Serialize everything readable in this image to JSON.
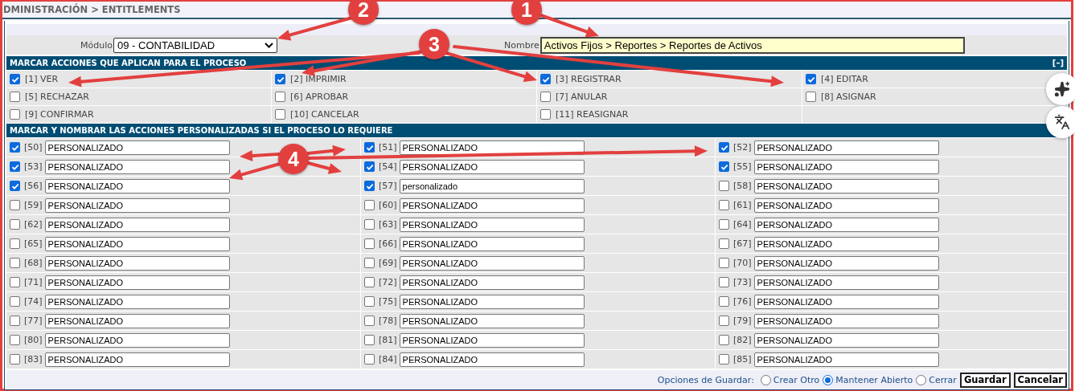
{
  "breadcrumb": "DMINISTRACIÓN > ENTITLEMENTS",
  "module": {
    "label": "Módulo",
    "value": "09 - CONTABILIDAD"
  },
  "name": {
    "label": "Nombre",
    "value": "Activos Fijos > Reportes > Reportes de Activos"
  },
  "standard_actions": {
    "title": "MARCAR ACCIONES QUE APLICAN PARA EL PROCESO",
    "toggle": "[–]",
    "items": [
      {
        "code": "[1]",
        "label": "VER",
        "checked": true
      },
      {
        "code": "[2]",
        "label": "IMPRIMIR",
        "checked": true
      },
      {
        "code": "[3]",
        "label": "REGISTRAR",
        "checked": true
      },
      {
        "code": "[4]",
        "label": "EDITAR",
        "checked": true
      },
      {
        "code": "[5]",
        "label": "RECHAZAR",
        "checked": false
      },
      {
        "code": "[6]",
        "label": "APROBAR",
        "checked": false
      },
      {
        "code": "[7]",
        "label": "ANULAR",
        "checked": false
      },
      {
        "code": "[8]",
        "label": "ASIGNAR",
        "checked": false
      },
      {
        "code": "[9]",
        "label": "CONFIRMAR",
        "checked": false
      },
      {
        "code": "[10]",
        "label": "CANCELAR",
        "checked": false
      },
      {
        "code": "[11]",
        "label": "REASIGNAR",
        "checked": false
      }
    ]
  },
  "custom_actions": {
    "title": "MARCAR Y NOMBRAR LAS ACCIONES PERSONALIZADAS SI EL PROCESO LO REQUIERE",
    "items": [
      {
        "code": "[50]",
        "value": "PERSONALIZADO",
        "checked": true
      },
      {
        "code": "[51]",
        "value": "PERSONALIZADO",
        "checked": true
      },
      {
        "code": "[52]",
        "value": "PERSONALIZADO",
        "checked": true
      },
      {
        "code": "[53]",
        "value": "PERSONALIZADO",
        "checked": true
      },
      {
        "code": "[54]",
        "value": "PERSONALIZADO",
        "checked": true
      },
      {
        "code": "[55]",
        "value": "PERSONALIZADO",
        "checked": true
      },
      {
        "code": "[56]",
        "value": "PERSONALIZADO",
        "checked": true
      },
      {
        "code": "[57]",
        "value": "personalizado",
        "checked": true
      },
      {
        "code": "[58]",
        "value": "PERSONALIZADO",
        "checked": false
      },
      {
        "code": "[59]",
        "value": "PERSONALIZADO",
        "checked": false
      },
      {
        "code": "[60]",
        "value": "PERSONALIZADO",
        "checked": false
      },
      {
        "code": "[61]",
        "value": "PERSONALIZADO",
        "checked": false
      },
      {
        "code": "[62]",
        "value": "PERSONALIZADO",
        "checked": false
      },
      {
        "code": "[63]",
        "value": "PERSONALIZADO",
        "checked": false
      },
      {
        "code": "[64]",
        "value": "PERSONALIZADO",
        "checked": false
      },
      {
        "code": "[65]",
        "value": "PERSONALIZADO",
        "checked": false
      },
      {
        "code": "[66]",
        "value": "PERSONALIZADO",
        "checked": false
      },
      {
        "code": "[67]",
        "value": "PERSONALIZADO",
        "checked": false
      },
      {
        "code": "[68]",
        "value": "PERSONALIZADO",
        "checked": false
      },
      {
        "code": "[69]",
        "value": "PERSONALIZADO",
        "checked": false
      },
      {
        "code": "[70]",
        "value": "PERSONALIZADO",
        "checked": false
      },
      {
        "code": "[71]",
        "value": "PERSONALIZADO",
        "checked": false
      },
      {
        "code": "[72]",
        "value": "PERSONALIZADO",
        "checked": false
      },
      {
        "code": "[73]",
        "value": "PERSONALIZADO",
        "checked": false
      },
      {
        "code": "[74]",
        "value": "PERSONALIZADO",
        "checked": false
      },
      {
        "code": "[75]",
        "value": "PERSONALIZADO",
        "checked": false
      },
      {
        "code": "[76]",
        "value": "PERSONALIZADO",
        "checked": false
      },
      {
        "code": "[77]",
        "value": "PERSONALIZADO",
        "checked": false
      },
      {
        "code": "[78]",
        "value": "PERSONALIZADO",
        "checked": false
      },
      {
        "code": "[79]",
        "value": "PERSONALIZADO",
        "checked": false
      },
      {
        "code": "[80]",
        "value": "PERSONALIZADO",
        "checked": false
      },
      {
        "code": "[81]",
        "value": "PERSONALIZADO",
        "checked": false
      },
      {
        "code": "[82]",
        "value": "PERSONALIZADO",
        "checked": false
      },
      {
        "code": "[83]",
        "value": "PERSONALIZADO",
        "checked": false
      },
      {
        "code": "[84]",
        "value": "PERSONALIZADO",
        "checked": false
      },
      {
        "code": "[85]",
        "value": "PERSONALIZADO",
        "checked": false
      }
    ]
  },
  "save_options": {
    "label": "Opciones de Guardar:",
    "options": [
      {
        "label": "Crear Otro",
        "selected": false
      },
      {
        "label": "Mantener Abierto",
        "selected": true
      },
      {
        "label": "Cerrar",
        "selected": false
      }
    ]
  },
  "buttons": [
    "Guardar",
    "Cancelar"
  ],
  "annotations": [
    {
      "label": "1"
    },
    {
      "label": "2"
    },
    {
      "label": "3"
    },
    {
      "label": "4"
    }
  ]
}
